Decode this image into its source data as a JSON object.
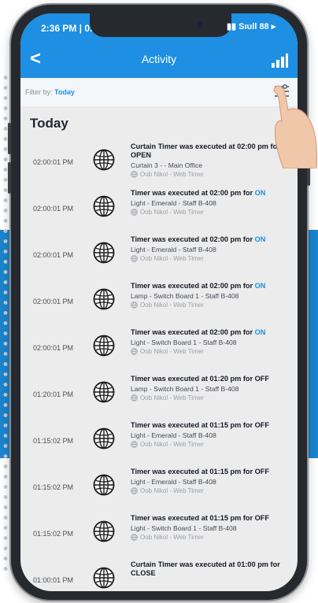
{
  "status_bar": {
    "time": "2:36 PM | 0...",
    "signal_text": "▮▮ Sıull 88 ▸"
  },
  "app_bar": {
    "back_label": "<",
    "title": "Activity",
    "signal_icon": "signal-bars-icon"
  },
  "filter": {
    "label": "Filter by:",
    "value": "Today",
    "icon": "filter-sliders-icon"
  },
  "section": {
    "title": "Today",
    "collapse_icon": "^"
  },
  "colors": {
    "primary": "#1e8fe2",
    "band": "#1b84cc",
    "state_on": "#1e8fe2"
  },
  "activities": [
    {
      "time": "02:00:01 PM",
      "title": "Curtain Timer was executed at 02:00 pm for OPEN",
      "state": "",
      "device": "Curtain 3 - - Main Office",
      "source": "Oob Nikol - Web Timer",
      "icon": "globe-icon"
    },
    {
      "time": "02:00:01 PM",
      "title": "Timer was executed at 02:00 pm for ",
      "state": "ON",
      "device": "Light - Emerald - Staff B-408",
      "source": "Oob Nikol - Web Timer",
      "icon": "globe-icon"
    },
    {
      "time": "02:00:01 PM",
      "title": "Timer was executed at 02:00 pm for ",
      "state": "ON",
      "device": "Light - Emerald - Staff B-408",
      "source": "Oob Nikol - Web Timer",
      "icon": "globe-icon"
    },
    {
      "time": "02:00:01 PM",
      "title": "Timer was executed at 02:00 pm for ",
      "state": "ON",
      "device": "Lamp - Switch Board 1 - Staff B-408",
      "source": "Oob Nikol - Web Timer",
      "icon": "globe-icon"
    },
    {
      "time": "02:00:01 PM",
      "title": "Timer was executed at 02:00 pm for ",
      "state": "ON",
      "device": "Light - Switch Board 1 - Staff B-408",
      "source": "Oob Nikol - Web Timer",
      "icon": "globe-icon"
    },
    {
      "time": "01:20:01 PM",
      "title": "Timer was executed at 01:20 pm for OFF",
      "state": "",
      "device": "Lamp - Switch Board 1 - Staff B-408",
      "source": "Oob Nikol - Web Timer",
      "icon": "globe-icon"
    },
    {
      "time": "01:15:02 PM",
      "title": "Timer was executed at 01:15 pm for OFF",
      "state": "",
      "device": "Light - Emerald - Staff B-408",
      "source": "Oob Nikol - Web Timer",
      "icon": "globe-icon"
    },
    {
      "time": "01:15:02 PM",
      "title": "Timer was executed at 01:15 pm for OFF",
      "state": "",
      "device": "Light - Emerald - Staff B-408",
      "source": "Oob Nikol - Web Timer",
      "icon": "globe-icon"
    },
    {
      "time": "01:15:02 PM",
      "title": "Timer was executed at 01:15 pm for OFF",
      "state": "",
      "device": "Light - Switch Board 1 - Staff B-408",
      "source": "Oob Nikol - Web Timer",
      "icon": "globe-icon"
    },
    {
      "time": "01:00:01 PM",
      "title": "Curtain Timer was executed at 01:00 pm for CLOSE",
      "state": "",
      "device": "",
      "source": "",
      "icon": "globe-icon"
    }
  ]
}
